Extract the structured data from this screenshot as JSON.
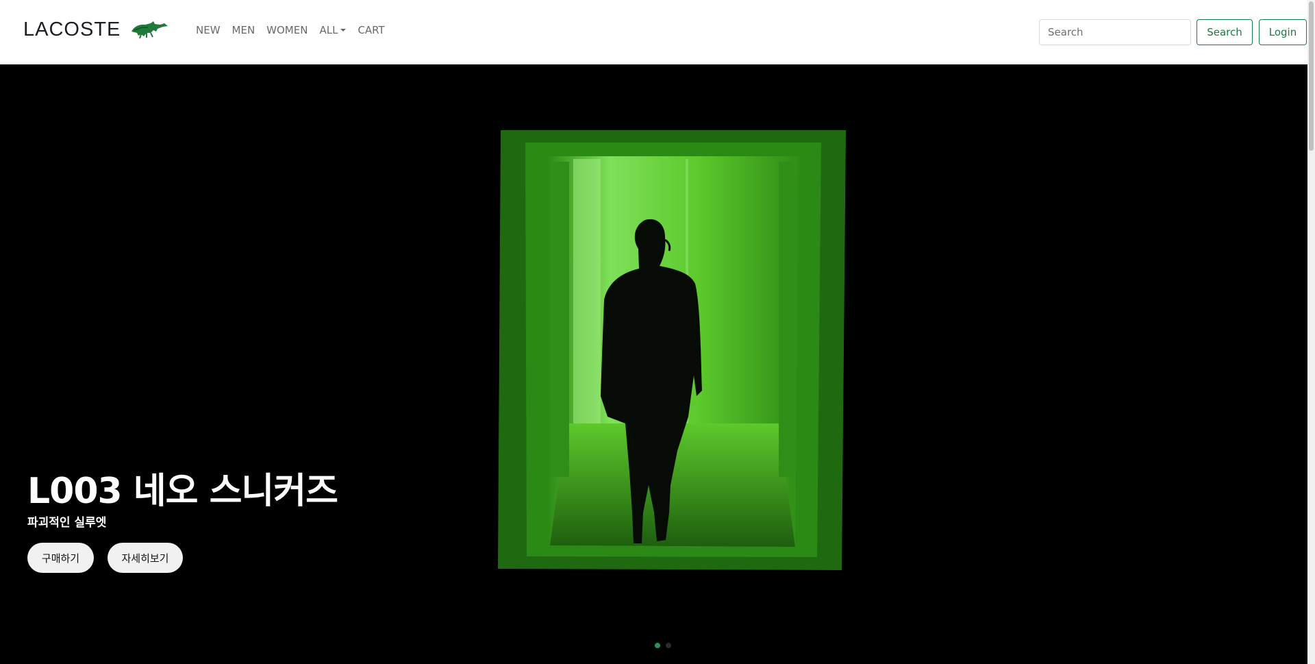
{
  "navbar": {
    "brand": "LACOSTE",
    "links": [
      "NEW",
      "MEN",
      "WOMEN",
      "ALL",
      "CART"
    ],
    "search_placeholder": "Search",
    "search_button": "Search",
    "login_button": "Login"
  },
  "hero": {
    "title": "L003 네오 스니커즈",
    "subtitle": "파괴적인 실루엣",
    "buy_button": "구매하기",
    "details_button": "자세히보기",
    "slide_count": 2,
    "active_slide": 1
  },
  "colors": {
    "brand_green": "#1b7a45",
    "hero_green": "#5ac828"
  }
}
